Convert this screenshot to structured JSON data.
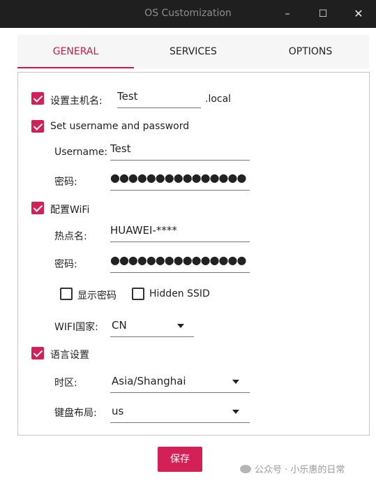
{
  "window": {
    "title": "OS Customization",
    "minimize": "–",
    "maximize": "☐",
    "close": "✕"
  },
  "tabs": [
    {
      "label": "GENERAL",
      "active": true
    },
    {
      "label": "SERVICES"
    },
    {
      "label": "OPTIONS"
    }
  ],
  "hostname": {
    "checked": true,
    "label": "设置主机名:",
    "value": "Test",
    "suffix": ".local"
  },
  "user": {
    "checked": true,
    "label": "Set username and password",
    "username_label": "Username:",
    "username": "Test",
    "password_label": "密码:",
    "password_mask": "●●●●●●●●●●●●●●●"
  },
  "wifi": {
    "checked": true,
    "label": "配置WiFi",
    "ssid_label": "热点名:",
    "ssid": "HUAWEI-****",
    "password_label": "密码:",
    "password_mask": "●●●●●●●●●●●●●●●",
    "show_password": {
      "checked": false,
      "label": "显示密码"
    },
    "hidden_ssid": {
      "checked": false,
      "label": "Hidden SSID"
    },
    "country_label": "WIFI国家:",
    "country": "CN"
  },
  "locale": {
    "checked": true,
    "label": "语言设置",
    "timezone_label": "时区:",
    "timezone": "Asia/Shanghai",
    "keyboard_label": "键盘布局:",
    "keyboard": "us"
  },
  "save_label": "保存",
  "watermark": "公众号 · 小乐惠的日常",
  "colors": {
    "accent": "#d32157",
    "titlebar": "#1f1f1f"
  }
}
